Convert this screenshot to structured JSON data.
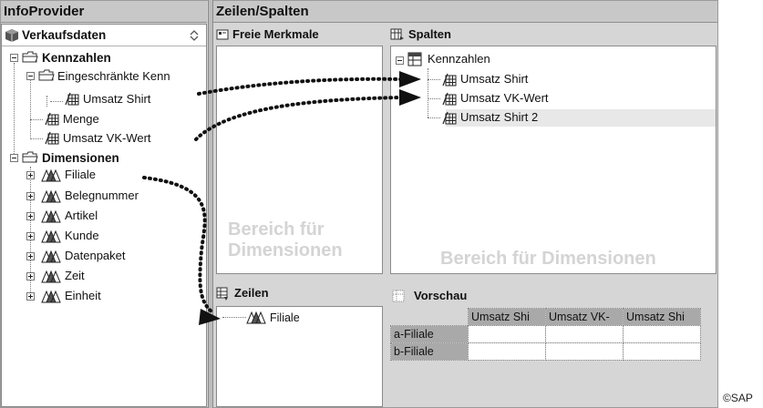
{
  "left_header": "InfoProvider",
  "right_header": "Zeilen/Spalten",
  "provider_name": "Verkaufsdaten",
  "provider_sort_icon": "sort-updown-icon",
  "tree": {
    "kennzahlen": "Kennzahlen",
    "eingeschraenkte": "Eingeschränkte Kenn",
    "umsatz_shirt": "Umsatz Shirt",
    "menge": "Menge",
    "umsatz_vk": "Umsatz VK-Wert",
    "dimensionen": "Dimensionen",
    "dims": [
      "Filiale",
      "Belegnummer",
      "Artikel",
      "Kunde",
      "Datenpaket",
      "Zeit",
      "Einheit"
    ]
  },
  "freie_merkmale": {
    "title": "Freie Merkmale",
    "placeholder_line1": "Bereich für",
    "placeholder_line2": "Dimensionen"
  },
  "spalten": {
    "title": "Spalten",
    "root": "Kennzahlen",
    "items": [
      "Umsatz Shirt",
      "Umsatz VK-Wert",
      "Umsatz Shirt 2"
    ],
    "placeholder": "Bereich für Dimensionen"
  },
  "zeilen": {
    "title": "Zeilen",
    "items": [
      "Filiale"
    ]
  },
  "vorschau": {
    "title": "Vorschau",
    "columns": [
      "Umsatz Shi",
      "Umsatz VK-",
      "Umsatz Shi"
    ],
    "rows": [
      "a-Filiale",
      "b-Filiale"
    ]
  },
  "copyright": "©SAP"
}
